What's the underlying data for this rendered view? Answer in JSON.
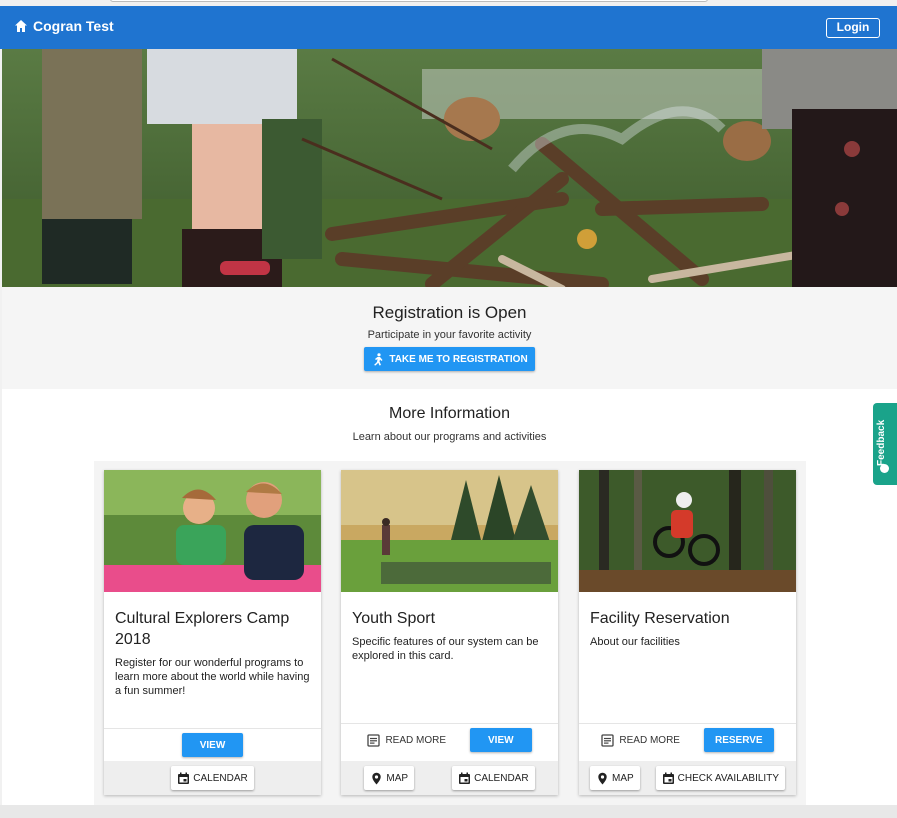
{
  "navbar": {
    "title": "Cogran Test",
    "login_label": "Login",
    "color": "#1f74d0"
  },
  "registration": {
    "heading": "Registration is Open",
    "subtext": "Participate in your favorite activity",
    "button_label": "TAKE ME TO REGISTRATION"
  },
  "info": {
    "heading": "More Information",
    "subtext": "Learn about our programs and activities"
  },
  "cards": [
    {
      "title": "Cultural Explorers Camp 2018",
      "description": "Register for our wonderful programs to learn more about the world while having a fun summer!",
      "view_label": "VIEW",
      "calendar_label": "CALENDAR"
    },
    {
      "title": "Youth Sport",
      "description": "Specific features of our system can be explored in this card.",
      "read_more_label": "READ MORE",
      "view_label": "VIEW",
      "map_label": "MAP",
      "calendar_label": "CALENDAR"
    },
    {
      "title": "Facility Reservation",
      "description": "About our facilities",
      "read_more_label": "READ MORE",
      "reserve_label": "RESERVE",
      "map_label": "MAP",
      "availability_label": "CHECK AVAILABILITY"
    }
  ],
  "feedback_label": "Feedback",
  "accent": "#2196f3",
  "feedback_color": "#1aa38a"
}
